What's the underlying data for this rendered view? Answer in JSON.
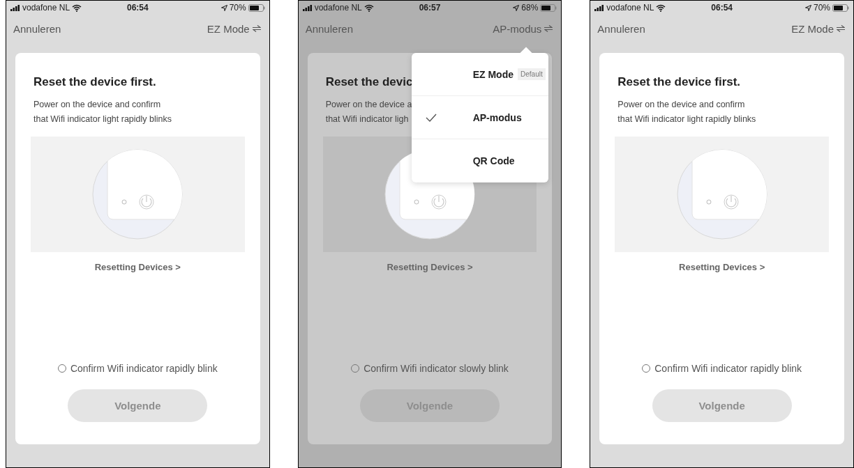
{
  "phones": [
    {
      "status": {
        "carrier": "vodafone NL",
        "time": "06:54",
        "battery": "70%"
      },
      "nav": {
        "cancel": "Annuleren",
        "mode": "EZ Mode"
      },
      "dimmed": false,
      "card": {
        "title": "Reset the device first.",
        "description": [
          "Power on the device and confirm",
          "that Wifi indicator light rapidly blinks"
        ],
        "link": "Resetting Devices >",
        "confirm": {
          "label": "Confirm Wifi indicator rapidly blink",
          "checked": false
        },
        "button": {
          "label": "Volgende",
          "disabled": true
        }
      }
    },
    {
      "status": {
        "carrier": "vodafone NL",
        "time": "06:57",
        "battery": "68%"
      },
      "nav": {
        "cancel": "Annuleren",
        "mode": "AP-modus"
      },
      "dimmed": true,
      "card": {
        "title": "Reset the devic",
        "description": [
          "Power on the device a",
          "that Wifi indicator ligh"
        ],
        "link": "Resetting Devices >",
        "confirm": {
          "label": "Confirm Wifi indicator slowly blink",
          "checked": false
        },
        "button": {
          "label": "Volgende",
          "disabled": true
        }
      },
      "menu": {
        "items": [
          {
            "label": "EZ Mode",
            "badge": "Default",
            "selected": false
          },
          {
            "label": "AP-modus",
            "selected": true
          },
          {
            "label": "QR Code",
            "selected": false
          }
        ]
      }
    },
    {
      "status": {
        "carrier": "vodafone NL",
        "time": "06:54",
        "battery": "70%"
      },
      "nav": {
        "cancel": "Annuleren",
        "mode": "EZ Mode"
      },
      "dimmed": false,
      "card": {
        "title": "Reset the device first.",
        "description": [
          "Power on the device and confirm",
          "that Wifi indicator light rapidly blinks"
        ],
        "link": "Resetting Devices >",
        "confirm": {
          "label": "Confirm Wifi indicator rapidly blink",
          "checked": false
        },
        "button": {
          "label": "Volgende",
          "disabled": true
        }
      }
    }
  ]
}
